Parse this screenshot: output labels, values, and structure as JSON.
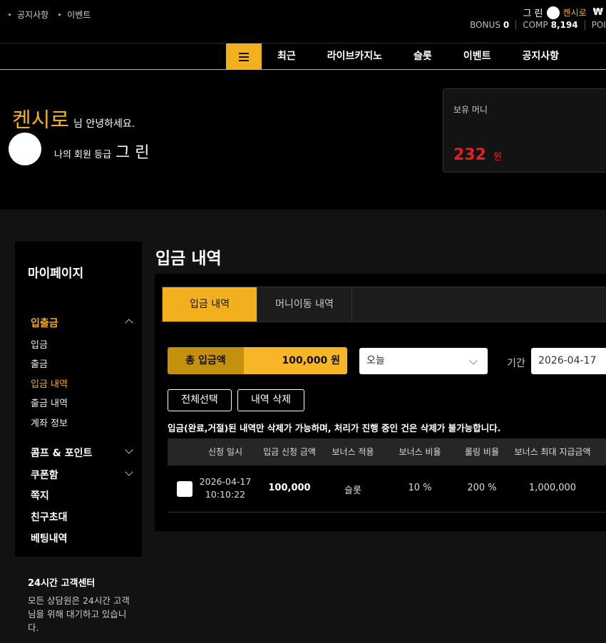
{
  "top_links": [
    "공지사항",
    "이벤트"
  ],
  "user": {
    "grade": "그 린",
    "name": "켄시로",
    "currency": "₩"
  },
  "points": {
    "bonus_label": "BONUS",
    "bonus_value": "0",
    "comp_label": "COMP",
    "comp_value": "8,194",
    "point_label": "POIN"
  },
  "nav": [
    "최근",
    "라이브카지노",
    "슬롯",
    "이벤트",
    "공지사항"
  ],
  "greeting": {
    "name": "켄시로",
    "suffix": "님 안녕하세요.",
    "grade_label": "나의 회원 등급",
    "grade_value": "그 린"
  },
  "money": {
    "label": "보유 머니",
    "amount": "232",
    "unit": "원"
  },
  "sidebar": {
    "title": "마이페이지",
    "group_deposit": "입출금",
    "sub_items": [
      "입금",
      "출금",
      "입금 내역",
      "출금 내역",
      "계좌 정보"
    ],
    "group_comp": "콤프 & 포인트",
    "group_coupon": "쿠폰함",
    "links": [
      "쪽지",
      "친구초대",
      "베팅내역"
    ],
    "support_title": "24시간 고객센터",
    "support_desc": "모든 상담원은 24시간 고객님을 위해 대기하고 있습니다."
  },
  "page": {
    "title": "입금 내역",
    "tabs": [
      "입금 내역",
      "머니이동 내역"
    ],
    "total_label": "총 입금액",
    "total_value": "100,000 원",
    "period_select": "오늘",
    "period_label": "기간",
    "date_value": "2026-04-17",
    "select_all": "전체선택",
    "delete": "내역 삭제",
    "notice": "입금(완료,거절)된 내역만 삭제가 가능하며, 처리가 진행 중인 건은 삭제가 불가능합니다."
  },
  "table": {
    "headers": [
      "신청 일시",
      "입금 신청 금액",
      "보너스 적용",
      "보너스 비율",
      "롤링 비율",
      "보너스 최대 지급금액"
    ],
    "rows": [
      {
        "date": "2026-04-17",
        "time": "10:10:22",
        "amount": "100,000",
        "bonus_type": "슬롯",
        "bonus_rate": "10 %",
        "rolling_rate": "200 %",
        "max_bonus": "1,000,000"
      }
    ]
  },
  "colors": {
    "accent": "#f2b01e",
    "money_red": "#e52020",
    "background": "#000000",
    "panel": "#121212"
  }
}
